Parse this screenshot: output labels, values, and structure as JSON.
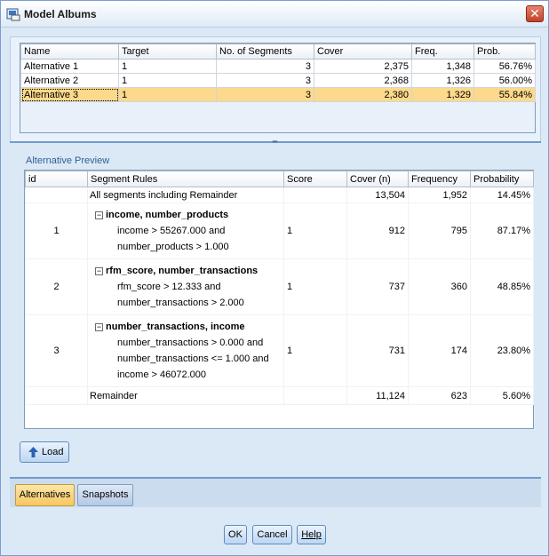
{
  "window": {
    "title": "Model Albums",
    "close_glyph": "✕"
  },
  "albums": {
    "columns": [
      "Name",
      "Target",
      "No. of Segments",
      "Cover",
      "Freq.",
      "Prob."
    ],
    "rows": [
      {
        "name": "Alternative 1",
        "target": "1",
        "segments": "3",
        "cover": "2,375",
        "freq": "1,348",
        "prob": "56.76%"
      },
      {
        "name": "Alternative 2",
        "target": "1",
        "segments": "3",
        "cover": "2,368",
        "freq": "1,326",
        "prob": "56.00%"
      },
      {
        "name": "Alternative 3",
        "target": "1",
        "segments": "3",
        "cover": "2,380",
        "freq": "1,329",
        "prob": "55.84%"
      }
    ],
    "selected_row": "Alternative 3"
  },
  "splitter": {
    "grip": "•••"
  },
  "preview": {
    "label": "Alternative Preview",
    "columns": [
      "id",
      "Segment Rules",
      "Score",
      "Cover (n)",
      "Frequency",
      "Probability"
    ],
    "all_row": {
      "rule": "All segments including Remainder",
      "cover": "13,504",
      "frequency": "1,952",
      "probability": "14.45%"
    },
    "segments": [
      {
        "id": "1",
        "head": "income, number_products",
        "lines": [
          "income > 55267.000 and",
          "number_products > 1.000"
        ],
        "score": "1",
        "cover": "912",
        "frequency": "795",
        "probability": "87.17%"
      },
      {
        "id": "2",
        "head": "rfm_score, number_transactions",
        "lines": [
          "rfm_score > 12.333 and",
          "number_transactions > 2.000"
        ],
        "score": "1",
        "cover": "737",
        "frequency": "360",
        "probability": "48.85%"
      },
      {
        "id": "3",
        "head": "number_transactions, income",
        "lines": [
          "number_transactions > 0.000 and",
          "number_transactions <= 1.000 and",
          "income > 46072.000"
        ],
        "score": "1",
        "cover": "731",
        "frequency": "174",
        "probability": "23.80%"
      }
    ],
    "remainder_row": {
      "rule": "Remainder",
      "cover": "11,124",
      "frequency": "623",
      "probability": "5.60%"
    },
    "collapse_glyph": "−"
  },
  "load_button": {
    "label": "Load",
    "icon": "up-arrow-icon"
  },
  "tabs": [
    {
      "label": "Alternatives",
      "active": true
    },
    {
      "label": "Snapshots",
      "active": false
    }
  ],
  "buttons": {
    "ok": "OK",
    "cancel": "Cancel",
    "help": "Help"
  },
  "colors": {
    "selection": "#fcd98b",
    "accent": "#6f9ccc",
    "close": "#c24228"
  }
}
